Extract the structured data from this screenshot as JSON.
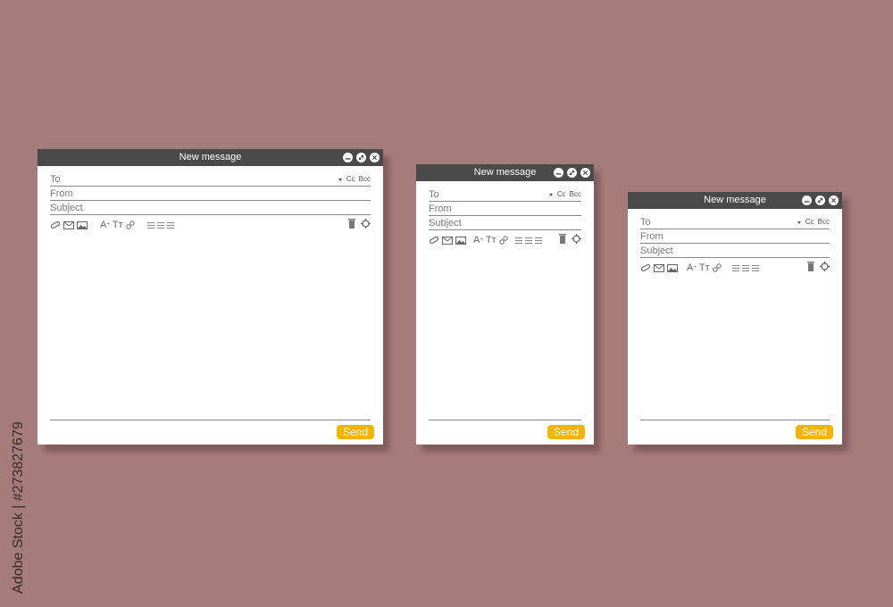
{
  "windows": [
    {
      "title": "New message",
      "fields": {
        "to": "To",
        "from": "From",
        "subject": "Subject"
      },
      "cc_label": "Cc",
      "bcc_label": "Bcc",
      "toolbar": {
        "font_size_label": "A",
        "font_size_sup": "+",
        "text_style_label": "Tт"
      },
      "send_label": "Send",
      "icons": [
        "minimize-icon",
        "maximize-icon",
        "close-icon",
        "paperclip-icon",
        "envelope-icon",
        "image-icon",
        "link-icon",
        "align-icon",
        "trash-icon",
        "settings-icon"
      ]
    },
    {
      "title": "New message",
      "fields": {
        "to": "To",
        "from": "From",
        "subject": "Subject"
      },
      "cc_label": "Cc",
      "bcc_label": "Bcc",
      "toolbar": {
        "font_size_label": "A",
        "font_size_sup": "+",
        "text_style_label": "Tт"
      },
      "send_label": "Send"
    },
    {
      "title": "New message",
      "fields": {
        "to": "To",
        "from": "From",
        "subject": "Subject"
      },
      "cc_label": "Cc",
      "bcc_label": "Bcc",
      "toolbar": {
        "font_size_label": "A",
        "font_size_sup": "+",
        "text_style_label": "Tт"
      },
      "send_label": "Send"
    }
  ],
  "colors": {
    "background": "#a67c7b",
    "titlebar": "#4a4a4a",
    "send_button": "#f4b400"
  },
  "side_text": "Adobe Stock | #273827679"
}
